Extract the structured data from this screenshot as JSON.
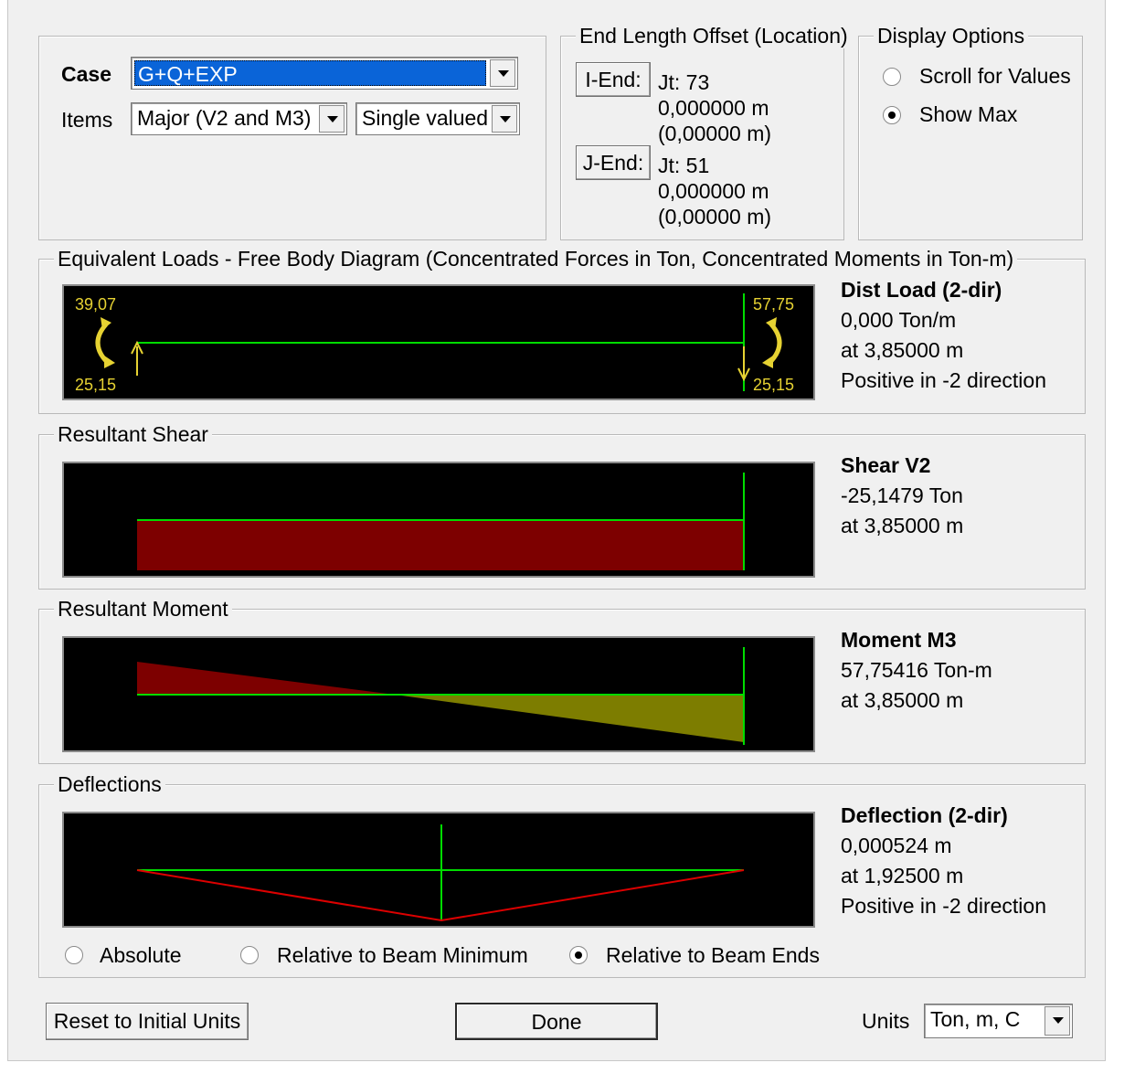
{
  "case": {
    "label": "Case",
    "value": "G+Q+EXP"
  },
  "items": {
    "label": "Items",
    "component": "Major (V2 and M3)",
    "mode": "Single valued"
  },
  "end_offset": {
    "title": "End Length Offset (Location)",
    "i_end": {
      "button": "I-End:",
      "jt": "Jt:  73",
      "offset": "0,000000 m",
      "location": "(0,00000 m)"
    },
    "j_end": {
      "button": "J-End:",
      "jt": "Jt:  51",
      "offset": "0,000000 m",
      "location": "(0,00000 m)"
    }
  },
  "display_options": {
    "title": "Display Options",
    "scroll": {
      "label": "Scroll for Values",
      "selected": false
    },
    "showmax": {
      "label": "Show Max",
      "selected": true
    }
  },
  "fbd": {
    "title": "Equivalent Loads - Free Body Diagram  (Concentrated Forces in Ton, Concentrated Moments in Ton-m)",
    "left_moment": "39,07",
    "left_force": "25,15",
    "right_moment": "57,75",
    "right_force": "25,15",
    "info_title": "Dist Load (2-dir)",
    "info_value": "0,000 Ton/m",
    "info_location": "at 3,85000 m",
    "info_note": "Positive in -2 direction"
  },
  "shear": {
    "title": "Resultant Shear",
    "info_title": "Shear V2",
    "info_value": "-25,1479 Ton",
    "info_location": "at 3,85000 m"
  },
  "moment": {
    "title": "Resultant Moment",
    "info_title": "Moment M3",
    "info_value": "57,75416 Ton-m",
    "info_location": "at 3,85000 m"
  },
  "deflection": {
    "title": "Deflections",
    "info_title": "Deflection (2-dir)",
    "info_value": "0,000524 m",
    "info_location": "at 1,92500 m",
    "info_note": "Positive in -2 direction",
    "options": {
      "absolute": {
        "label": "Absolute",
        "selected": false
      },
      "rel_min": {
        "label": "Relative to Beam Minimum",
        "selected": false
      },
      "rel_ends": {
        "label": "Relative to Beam Ends",
        "selected": true
      }
    }
  },
  "buttons": {
    "reset": "Reset to Initial Units",
    "done": "Done"
  },
  "units": {
    "label": "Units",
    "value": "Ton, m, C"
  },
  "colors": {
    "plot_bg": "#000000",
    "axis": "#00dc00",
    "shear_fill": "#7d0000",
    "moment_neg": "#7d0000",
    "moment_pos": "#7d7d00",
    "deflection_line": "#dc0000",
    "load_arrows": "#e6d232"
  }
}
